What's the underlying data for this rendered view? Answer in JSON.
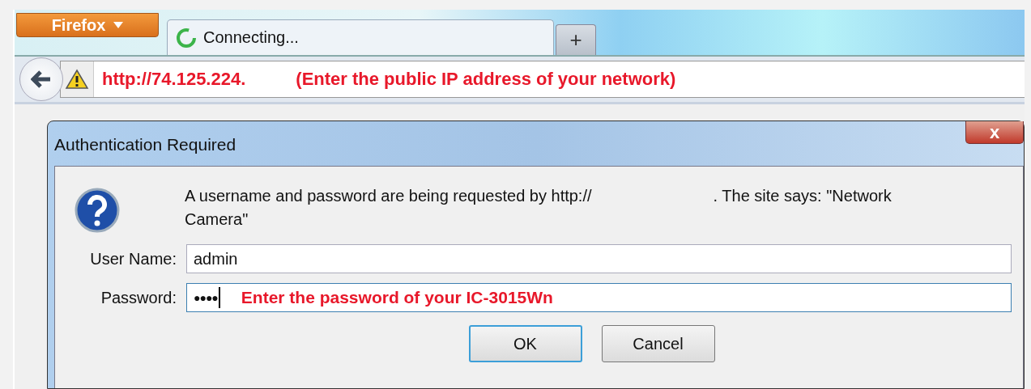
{
  "browser": {
    "menu_button": "Firefox",
    "tabs": [
      {
        "label": "Connecting...",
        "selected": true,
        "loading": true
      }
    ],
    "new_tab": "+",
    "address": "http://74.125.224.",
    "address_note": "(Enter the public IP address of your network)"
  },
  "dialog": {
    "title": "Authentication Required",
    "close": "x",
    "message_before": "A username and password are being requested by http://",
    "message_after": ". The site says: \"Network Camera\"",
    "fields": [
      {
        "label": "User Name:",
        "value": "admin",
        "focused": false
      },
      {
        "label": "Password:",
        "value": "●●●●",
        "focused": true,
        "note": "Enter the password of your IC-3015Wn"
      }
    ],
    "buttons": [
      {
        "label": "OK",
        "default": true
      },
      {
        "label": "Cancel",
        "default": false
      }
    ]
  }
}
